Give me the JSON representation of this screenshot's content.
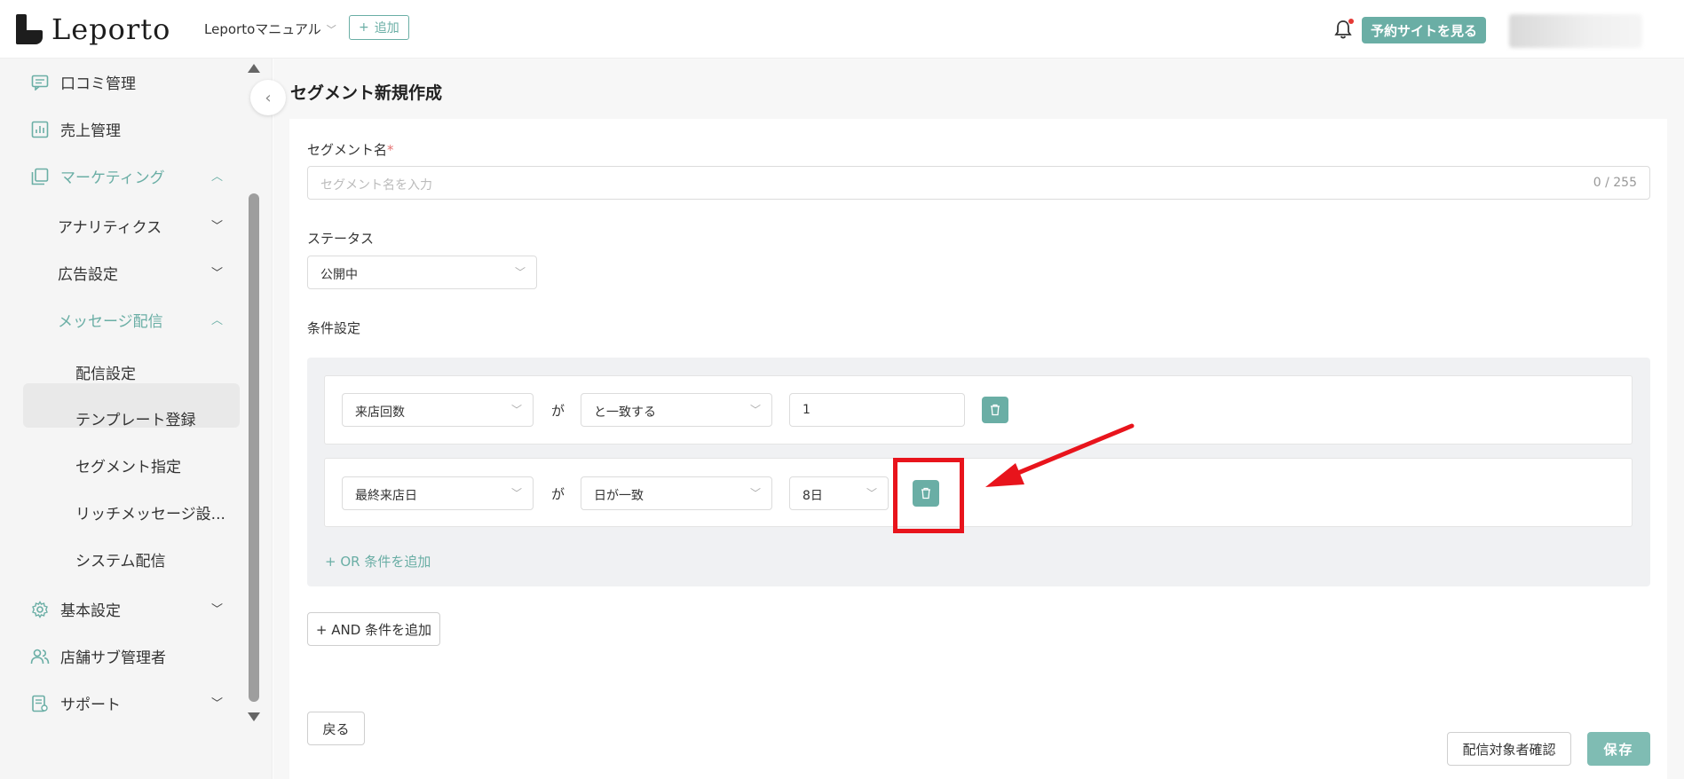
{
  "header": {
    "logo_text": "Leporto",
    "shop_name": "Leportoマニュアル",
    "add_label": "追加",
    "view_site_label": "予約サイトを見る"
  },
  "sidebar": {
    "items": [
      {
        "label": "口コミ管理",
        "icon": "chat-icon"
      },
      {
        "label": "売上管理",
        "icon": "chart-icon"
      },
      {
        "label": "マーケティング",
        "icon": "copy-icon"
      },
      {
        "label": "アナリティクス"
      },
      {
        "label": "広告設定"
      },
      {
        "label": "メッセージ配信"
      },
      {
        "label": "配信設定"
      },
      {
        "label": "テンプレート登録"
      },
      {
        "label": "セグメント指定"
      },
      {
        "label": "リッチメッセージ設..."
      },
      {
        "label": "システム配信"
      },
      {
        "label": "基本設定",
        "icon": "gear-icon"
      },
      {
        "label": "店舗サブ管理者",
        "icon": "users-icon"
      },
      {
        "label": "サポート",
        "icon": "document-icon"
      }
    ]
  },
  "main": {
    "page_title": "セグメント新規作成",
    "segment_name_label": "セグメント名",
    "required_mark": "*",
    "segment_name_placeholder": "セグメント名を入力",
    "segment_name_count": "0 / 255",
    "status_label": "ステータス",
    "status_value": "公開中",
    "conditions_label": "条件設定",
    "conditions": [
      {
        "field": "来店回数",
        "connector": "が",
        "operator": "と一致する",
        "value": "1"
      },
      {
        "field": "最終来店日",
        "connector": "が",
        "operator": "日が一致",
        "value": "8日"
      }
    ],
    "or_add_label": "+ OR 条件を追加",
    "and_add_label": "+ AND 条件を追加",
    "back_label": "戻る",
    "confirm_label": "配信対象者確認",
    "save_label": "保存"
  },
  "colors": {
    "accent": "#6aaea5",
    "annotation": "#e8141c"
  }
}
